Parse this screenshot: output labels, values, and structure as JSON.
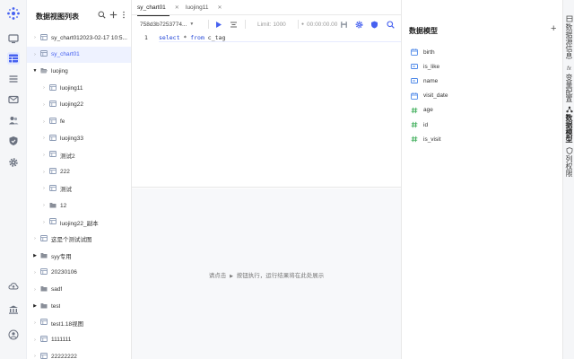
{
  "tree": {
    "title": "数据视图列表",
    "nodes": [
      {
        "label": "sy_chart012023-02-17 10:5...",
        "type": "view",
        "level": 0,
        "expandable": false,
        "selected": false
      },
      {
        "label": "sy_chart01",
        "type": "view",
        "level": 0,
        "expandable": false,
        "selected": true
      },
      {
        "label": "luojing",
        "type": "folder-open",
        "level": 0,
        "expandable": true,
        "expanded": true,
        "selected": false
      },
      {
        "label": "luojing11",
        "type": "view",
        "level": 1,
        "expandable": false,
        "selected": false
      },
      {
        "label": "luojing22",
        "type": "view",
        "level": 1,
        "expandable": false,
        "selected": false
      },
      {
        "label": "fe",
        "type": "view",
        "level": 1,
        "expandable": false,
        "selected": false
      },
      {
        "label": "luojing33",
        "type": "view",
        "level": 1,
        "expandable": false,
        "selected": false
      },
      {
        "label": "测试2",
        "type": "view",
        "level": 1,
        "expandable": false,
        "selected": false
      },
      {
        "label": "222",
        "type": "view",
        "level": 1,
        "expandable": false,
        "selected": false
      },
      {
        "label": "测试",
        "type": "view",
        "level": 1,
        "expandable": false,
        "selected": false
      },
      {
        "label": "12",
        "type": "folder",
        "level": 1,
        "expandable": false,
        "selected": false
      },
      {
        "label": "luojing22_副本",
        "type": "view",
        "level": 1,
        "expandable": false,
        "selected": false
      },
      {
        "label": "这是个测试试图",
        "type": "view",
        "level": 0,
        "expandable": false,
        "selected": false
      },
      {
        "label": "syy专用",
        "type": "folder",
        "level": 0,
        "expandable": true,
        "selected": false
      },
      {
        "label": "20230106",
        "type": "view",
        "level": 0,
        "expandable": false,
        "selected": false
      },
      {
        "label": "sadf",
        "type": "folder",
        "level": 0,
        "expandable": false,
        "selected": false
      },
      {
        "label": "test",
        "type": "folder",
        "level": 0,
        "expandable": true,
        "selected": false
      },
      {
        "label": "test1.18视图",
        "type": "view",
        "level": 0,
        "expandable": false,
        "selected": false
      },
      {
        "label": "1111111",
        "type": "view",
        "level": 0,
        "expandable": false,
        "selected": false
      },
      {
        "label": "22222222",
        "type": "view",
        "level": 0,
        "expandable": false,
        "selected": false
      }
    ]
  },
  "tabs": [
    {
      "label": "sy_chart01",
      "active": true
    },
    {
      "label": "luojing11",
      "active": false
    }
  ],
  "toolbar": {
    "source": "758d3b7253774...",
    "limit": "Limit: 1000",
    "timer": "00:00:00.00"
  },
  "editor": {
    "line_number": "1",
    "code_keyword_1": "select",
    "code_symbol": " * ",
    "code_keyword_2": "from",
    "code_table": " c_tag"
  },
  "results": {
    "hint_prefix": "请点击",
    "hint_suffix": "按钮执行，运行结果将在此处展示"
  },
  "model": {
    "title": "数据模型",
    "fields": [
      {
        "name": "birth",
        "type": "date"
      },
      {
        "name": "is_like",
        "type": "string"
      },
      {
        "name": "name",
        "type": "string"
      },
      {
        "name": "visit_date",
        "type": "date"
      },
      {
        "name": "age",
        "type": "number"
      },
      {
        "name": "id",
        "type": "number"
      },
      {
        "name": "is_visit",
        "type": "number"
      }
    ]
  },
  "side_tabs": [
    {
      "label": "数据源信息",
      "icon": "database-icon",
      "active": false
    },
    {
      "label": "变量配置",
      "icon": "fx-icon",
      "active": false
    },
    {
      "label": "数据模型",
      "icon": "model-icon",
      "active": true
    },
    {
      "label": "列权限",
      "icon": "shield-icon",
      "active": false
    }
  ],
  "colors": {
    "accent": "#4661f0",
    "view_icon": "#8c9bb5",
    "folder_icon": "#8a8f99",
    "date_icon": "#4a86e8",
    "number_icon": "#3fae5a"
  }
}
